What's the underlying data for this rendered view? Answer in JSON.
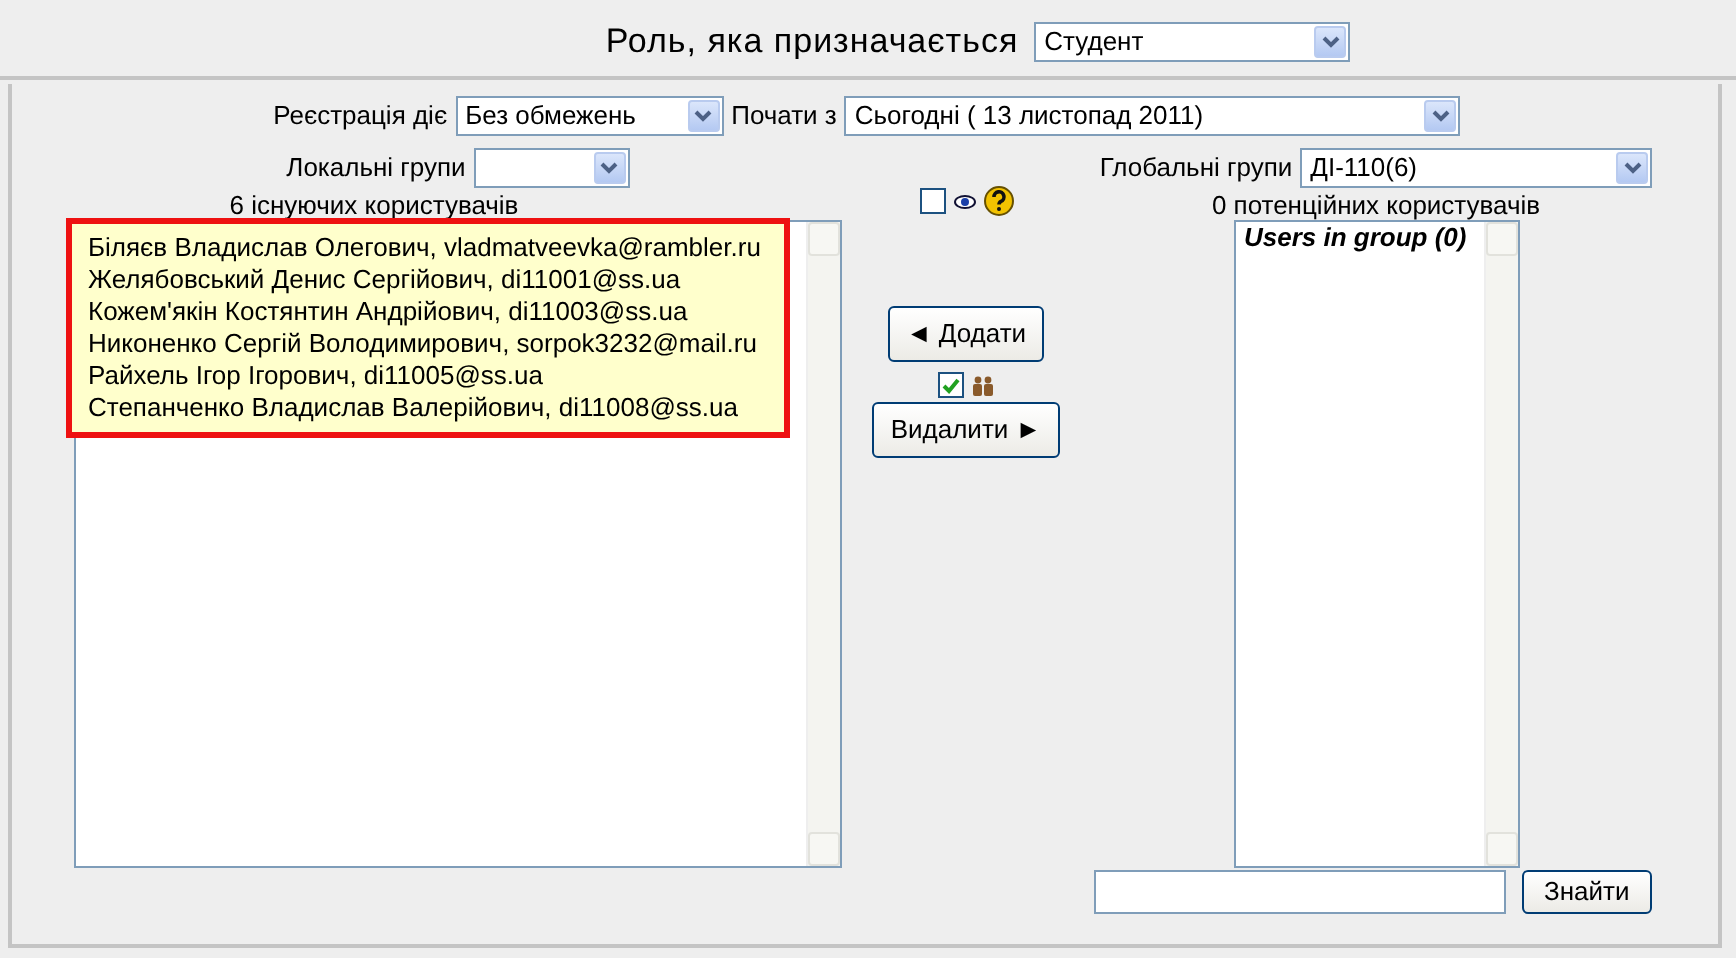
{
  "role": {
    "label": "Роль, яка призначається",
    "value": "Студент"
  },
  "enrolment": {
    "duration_label": "Реєстрація діє",
    "duration_value": "Без обмежень",
    "start_label": "Почати з",
    "start_value": "Сьогодні ( 13 листопад 2011)"
  },
  "local_groups": {
    "label": "Локальні групи"
  },
  "global_groups": {
    "label": "Глобальні групи",
    "value": "ДІ-110(6)"
  },
  "existing": {
    "heading": "6 існуючих користувачів",
    "highlighted": true,
    "users": [
      "Біляєв Владислав Олегович, vladmatveevka@rambler.ru",
      "Желябовський Денис Сергійович, di11001@ss.ua",
      "Кожем'якін Костянтин Андрійович, di11003@ss.ua",
      "Никоненко Сергій Володимирович, sorpok3232@mail.ru",
      "Райхель Ігор Ігорович, di11005@ss.ua",
      "Степанченко Владислав Валерійович, di11008@ss.ua"
    ]
  },
  "show_hidden": {
    "checked": false
  },
  "add_button": {
    "label": "◄ Додати"
  },
  "group_filter": {
    "checked": true
  },
  "remove_button": {
    "label": "Видалити ►"
  },
  "potential": {
    "heading": "0 потенційних користувачів",
    "group_header": "Users in group (0)"
  },
  "search": {
    "button": "Знайти"
  }
}
